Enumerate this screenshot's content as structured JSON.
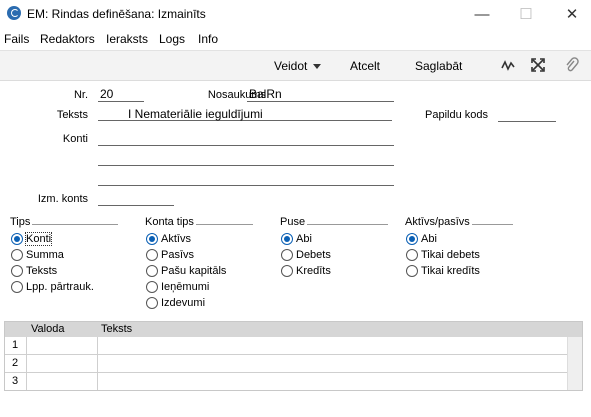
{
  "window": {
    "title": "EM: Rindas definēšana: Izmainīts"
  },
  "titlebar_buttons": {
    "minimize": "—",
    "maximize": "☐",
    "close": "✕"
  },
  "menu": [
    "Fails",
    "Redaktors",
    "Ieraksts",
    "Logs",
    "Info"
  ],
  "toolbar": {
    "create": "Veidot",
    "cancel": "Atcelt",
    "save": "Saglabāt"
  },
  "form": {
    "nr_label": "Nr.",
    "nr_value": "20",
    "name_label": "Nosaukums",
    "name_value": "BalRn",
    "text_label": "Teksts",
    "text_value": "I Nemateriālie ieguldījumi",
    "extra_code_label": "Papildu kods",
    "extra_code_value": "",
    "accounts_label": "Konti",
    "accounts_values": [
      "",
      "",
      ""
    ],
    "exclude_label": "Izm. konts",
    "exclude_value": ""
  },
  "groups": {
    "tips": {
      "title": "Tips",
      "options": [
        "Konti",
        "Summa",
        "Teksts",
        "Lpp. pārtrauk."
      ],
      "selected": 0
    },
    "konta_tips": {
      "title": "Konta tips",
      "options": [
        "Aktīvs",
        "Pasīvs",
        "Pašu kapitāls",
        "Ieņēmumi",
        "Izdevumi"
      ],
      "selected": 0
    },
    "puse": {
      "title": "Puse",
      "options": [
        "Abi",
        "Debets",
        "Kredīts"
      ],
      "selected": 0
    },
    "aktivs_pasivs": {
      "title": "Aktīvs/pasīvs",
      "options": [
        "Abi",
        "Tikai debets",
        "Tikai kredīts"
      ],
      "selected": 0
    }
  },
  "table": {
    "columns": [
      "Valoda",
      "Teksts"
    ],
    "rows": [
      {
        "num": "1",
        "valoda": "",
        "teksts": ""
      },
      {
        "num": "2",
        "valoda": "",
        "teksts": ""
      },
      {
        "num": "3",
        "valoda": "",
        "teksts": ""
      }
    ]
  }
}
